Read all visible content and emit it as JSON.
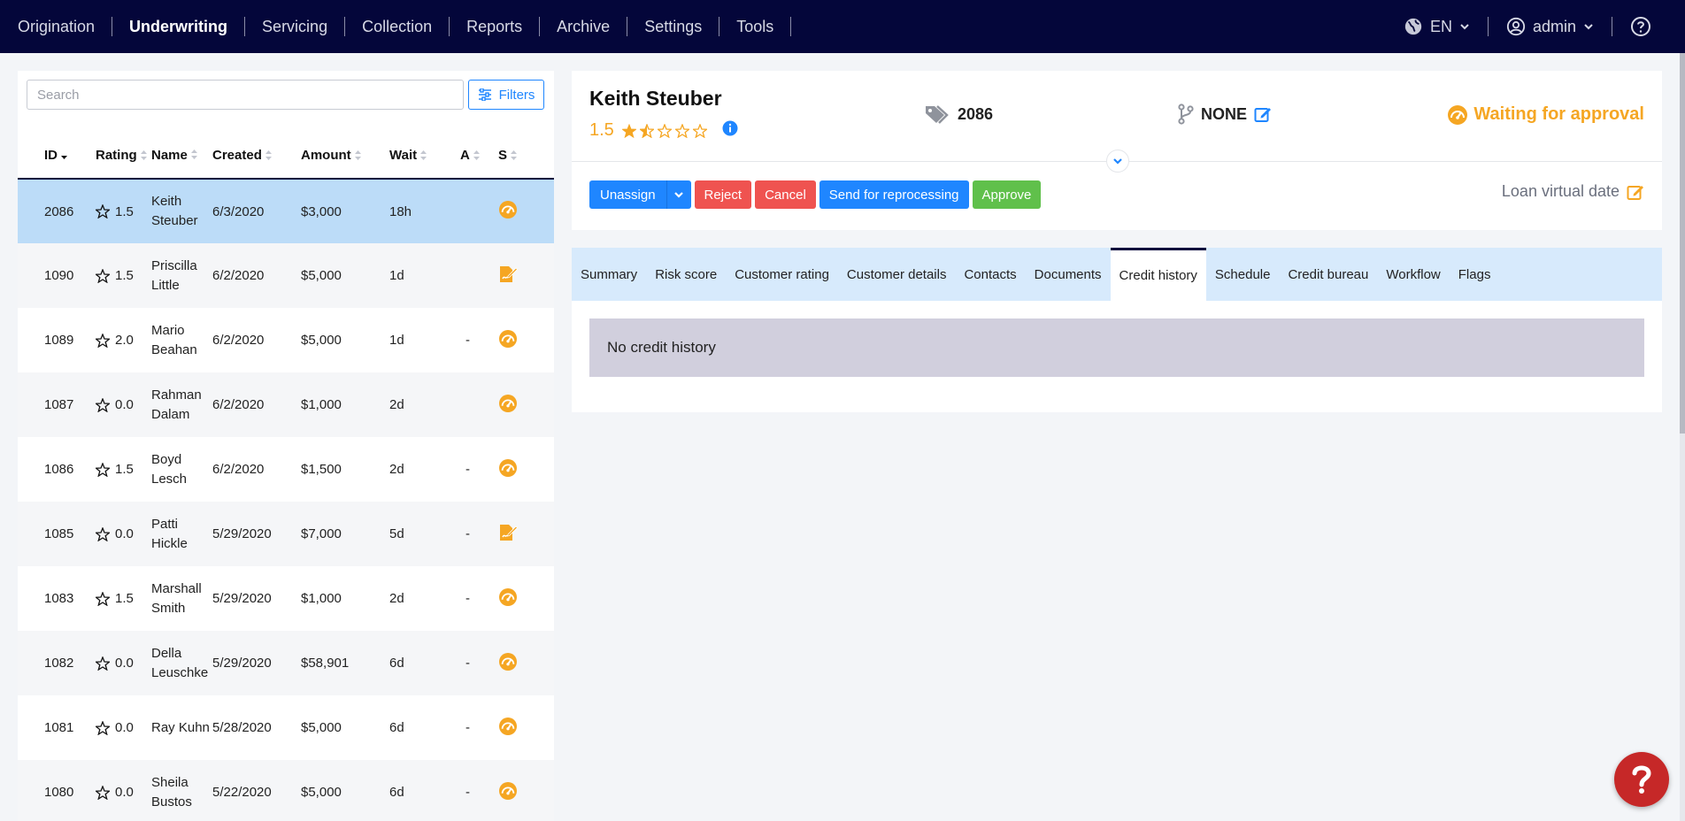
{
  "nav": {
    "items": [
      "Origination",
      "Underwriting",
      "Servicing",
      "Collection",
      "Reports",
      "Archive",
      "Settings",
      "Tools"
    ],
    "active": "Underwriting",
    "language": "EN",
    "user": "admin"
  },
  "search": {
    "placeholder": "Search",
    "filters_label": "Filters"
  },
  "table": {
    "columns": [
      "ID",
      "Rating",
      "Name",
      "Created",
      "Amount",
      "Wait",
      "A",
      "S"
    ],
    "rows": [
      {
        "id": "2086",
        "rating": "1.5",
        "name": "Keith Steuber",
        "created": "6/3/2020",
        "amount": "$3,000",
        "wait": "18h",
        "a": "",
        "status_icon": "gauge-icon"
      },
      {
        "id": "1090",
        "rating": "1.5",
        "name": "Priscilla Little",
        "created": "6/2/2020",
        "amount": "$5,000",
        "wait": "1d",
        "a": "",
        "status_icon": "signature-icon"
      },
      {
        "id": "1089",
        "rating": "2.0",
        "name": "Mario Beahan",
        "created": "6/2/2020",
        "amount": "$5,000",
        "wait": "1d",
        "a": "-",
        "status_icon": "gauge-icon"
      },
      {
        "id": "1087",
        "rating": "0.0",
        "name": "Rahman Dalam",
        "created": "6/2/2020",
        "amount": "$1,000",
        "wait": "2d",
        "a": "",
        "status_icon": "gauge-icon"
      },
      {
        "id": "1086",
        "rating": "1.5",
        "name": "Boyd Lesch",
        "created": "6/2/2020",
        "amount": "$1,500",
        "wait": "2d",
        "a": "-",
        "status_icon": "gauge-icon"
      },
      {
        "id": "1085",
        "rating": "0.0",
        "name": "Patti Hickle",
        "created": "5/29/2020",
        "amount": "$7,000",
        "wait": "5d",
        "a": "-",
        "status_icon": "signature-icon"
      },
      {
        "id": "1083",
        "rating": "1.5",
        "name": "Marshall Smith",
        "created": "5/29/2020",
        "amount": "$1,000",
        "wait": "2d",
        "a": "-",
        "status_icon": "gauge-icon"
      },
      {
        "id": "1082",
        "rating": "0.0",
        "name": "Della Leuschke",
        "created": "5/29/2020",
        "amount": "$58,901",
        "wait": "6d",
        "a": "-",
        "status_icon": "gauge-icon"
      },
      {
        "id": "1081",
        "rating": "0.0",
        "name": "Ray Kuhn",
        "created": "5/28/2020",
        "amount": "$5,000",
        "wait": "6d",
        "a": "-",
        "status_icon": "gauge-icon"
      },
      {
        "id": "1080",
        "rating": "0.0",
        "name": "Sheila Bustos",
        "created": "5/22/2020",
        "amount": "$5,000",
        "wait": "6d",
        "a": "-",
        "status_icon": "gauge-icon"
      }
    ]
  },
  "customer": {
    "name": "Keith Steuber",
    "rating": "1.5",
    "loan_id": "2086",
    "workflow": "NONE",
    "status": "Waiting for approval"
  },
  "actions": {
    "unassign": "Unassign",
    "reject": "Reject",
    "cancel": "Cancel",
    "reprocess": "Send for reprocessing",
    "approve": "Approve",
    "virtual_date": "Loan virtual date"
  },
  "tabs": [
    "Summary",
    "Risk score",
    "Customer rating",
    "Customer details",
    "Contacts",
    "Documents",
    "Credit history",
    "Schedule",
    "Credit bureau",
    "Workflow",
    "Flags"
  ],
  "active_tab": "Credit history",
  "credit_history": {
    "empty_text": "No credit history"
  },
  "colors": {
    "nav_bg": "#04063a",
    "accent": "#1f86ff",
    "warning": "#f5a623",
    "danger": "#ef5350",
    "success": "#60c04b",
    "selected_row": "#bcdcf8"
  }
}
